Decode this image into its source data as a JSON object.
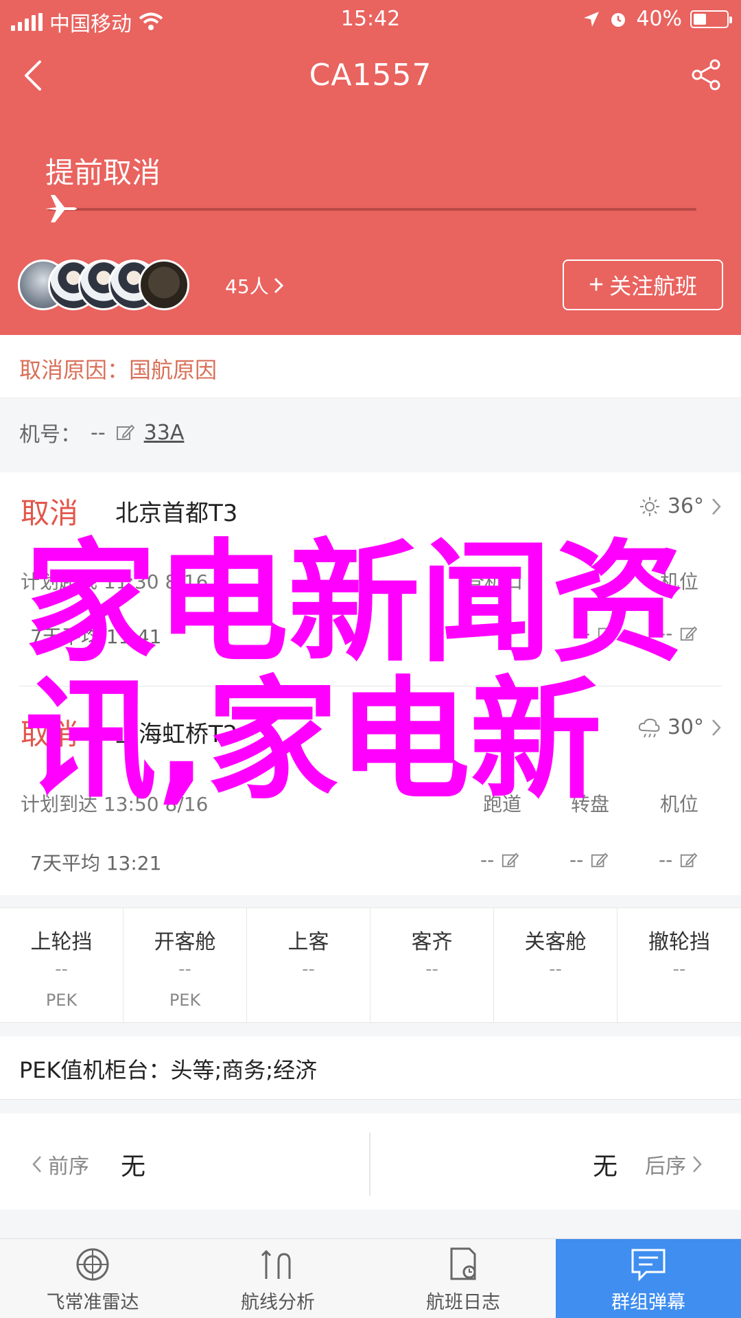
{
  "status_bar": {
    "carrier": "中国移动",
    "time": "15:42",
    "battery_percent": "40%",
    "battery_level": 0.4
  },
  "nav": {
    "title": "CA1557"
  },
  "flight_status": {
    "text": "提前取消",
    "progress": 0.0
  },
  "social": {
    "followers": "45人",
    "follow_button": "关注航班"
  },
  "cancel_reason": "取消原因：国航原因",
  "aircraft": {
    "label": "机号：",
    "number": "--",
    "type": "33A"
  },
  "departure": {
    "status": "取消",
    "airport": "北京首都T3",
    "temperature": "36°",
    "sched_label": "计划起飞",
    "sched_time": "11:30",
    "sched_date": "8/16",
    "col_gate": "登机口",
    "col_position": "机位",
    "avg_label": "7天平均",
    "avg_time": "11:41",
    "val_gate": "--",
    "val_position": "--"
  },
  "arrival": {
    "status": "取消",
    "airport": "上海虹桥T2",
    "temperature": "30°",
    "sched_label": "计划到达",
    "sched_time": "13:50",
    "sched_date": "8/16",
    "col_runway": "跑道",
    "col_carousel": "转盘",
    "col_position": "机位",
    "avg_label": "7天平均",
    "avg_time": "13:21",
    "val_runway": "--",
    "val_carousel": "--",
    "val_position": "--"
  },
  "grid": [
    {
      "label": "上轮挡",
      "value": "--",
      "code": "PEK"
    },
    {
      "label": "开客舱",
      "value": "--",
      "code": "PEK"
    },
    {
      "label": "上客",
      "value": "--",
      "code": ""
    },
    {
      "label": "客齐",
      "value": "--",
      "code": ""
    },
    {
      "label": "关客舱",
      "value": "--",
      "code": ""
    },
    {
      "label": "撤轮挡",
      "value": "--",
      "code": ""
    }
  ],
  "checkin_counter": "PEK值机柜台：头等;商务;经济",
  "sequence": {
    "prev_label": "前序",
    "prev_value": "无",
    "next_label": "后序",
    "next_value": "无"
  },
  "tabs": [
    {
      "label": "飞常准雷达",
      "icon": "radar-icon"
    },
    {
      "label": "航线分析",
      "icon": "route-icon"
    },
    {
      "label": "航班日志",
      "icon": "log-icon"
    },
    {
      "label": "群组弹幕",
      "icon": "chat-icon"
    }
  ],
  "overlay_text": "家电新闻资讯,家电新",
  "colors": {
    "header_red": "#e9635f",
    "cancel_red": "#e2564b",
    "active_tab_blue": "#3f8ef0",
    "overlay_magenta": "#ff00ff"
  }
}
